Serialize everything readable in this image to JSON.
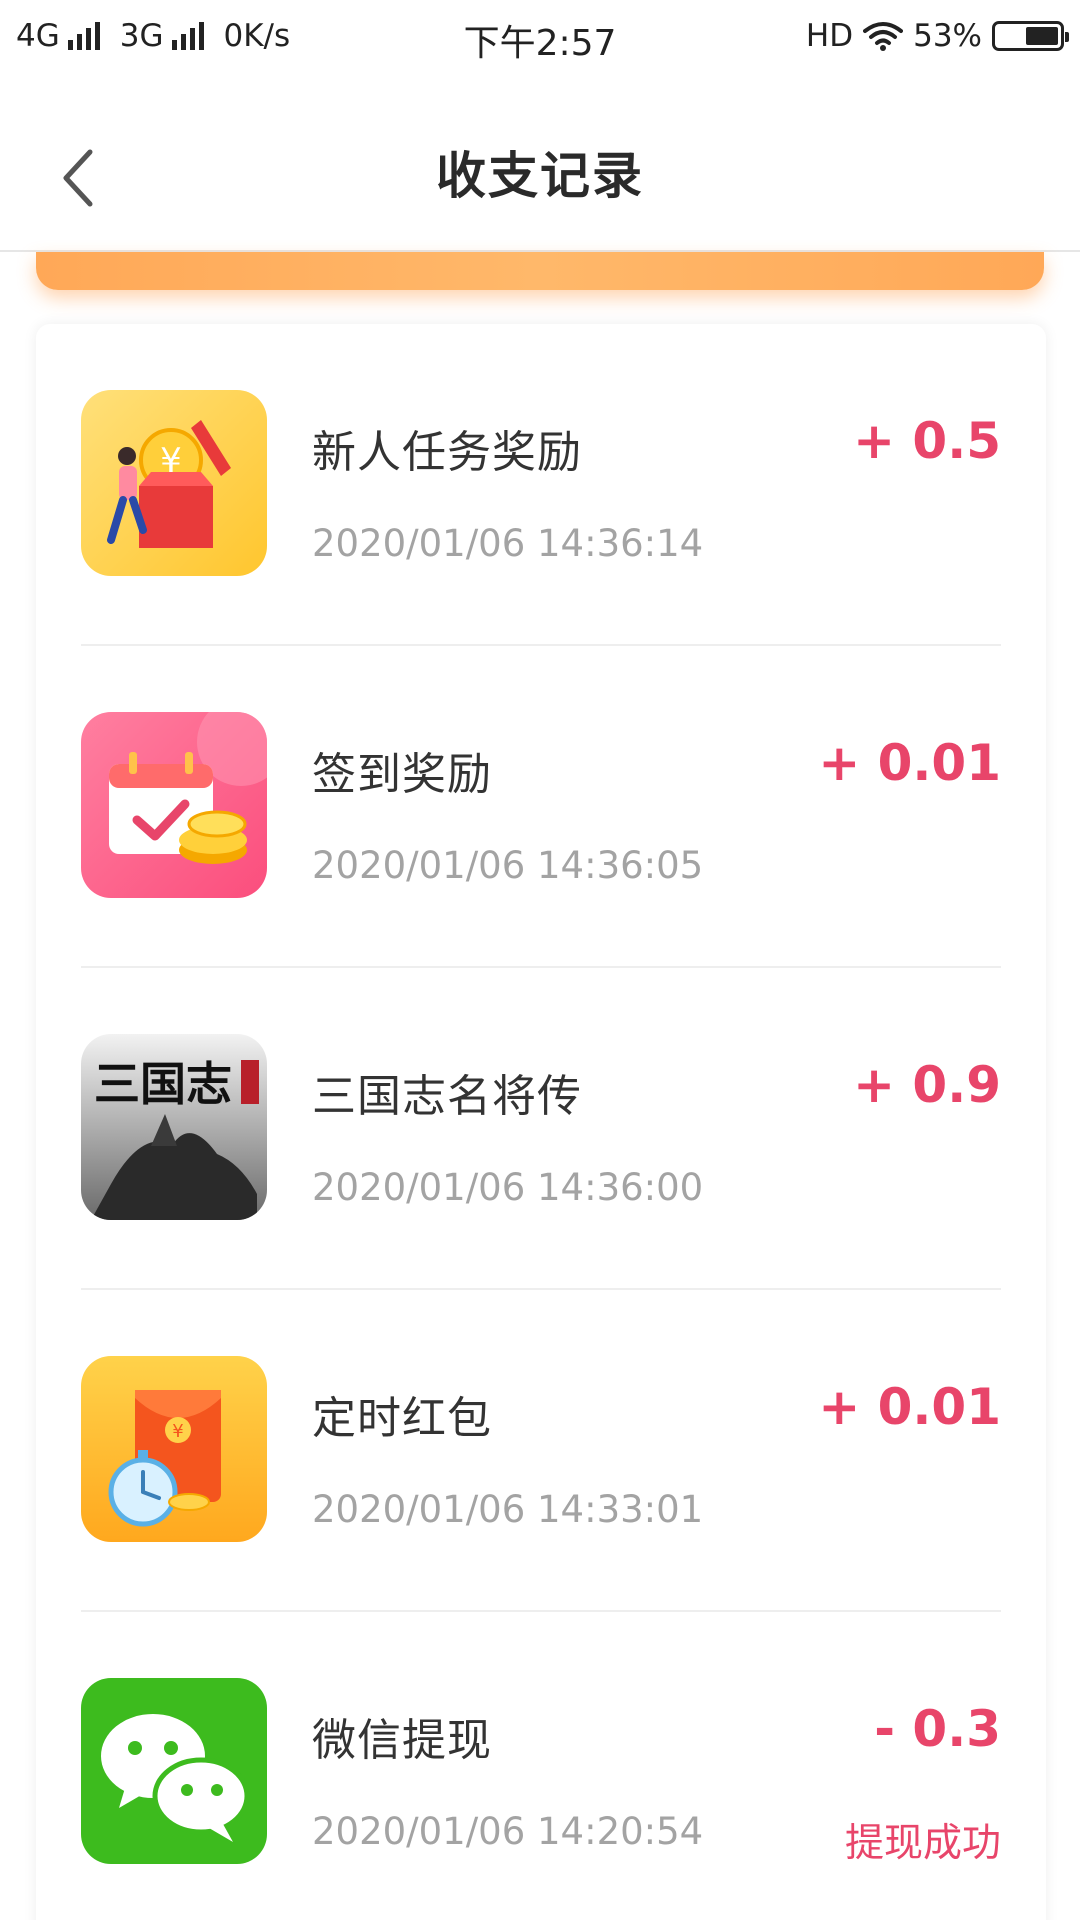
{
  "status_bar": {
    "network_1": "4G",
    "network_2": "3G",
    "speed": "0K/s",
    "time": "下午2:57",
    "hd": "HD",
    "battery": "53%",
    "battery_level": 0.53
  },
  "nav": {
    "title": "收支记录",
    "back_icon": "chevron-left-icon"
  },
  "colors": {
    "accent": "#e8456a",
    "banner": "#ffab5e"
  },
  "records": [
    {
      "icon": "gift-box-icon",
      "title": "新人任务奖励",
      "time": "2020/01/06 14:36:14",
      "amount": "+ 0.5",
      "status": ""
    },
    {
      "icon": "calendar-checkin-icon",
      "title": "签到奖励",
      "time": "2020/01/06 14:36:05",
      "amount": "+ 0.01",
      "status": ""
    },
    {
      "icon": "game-sanguozhi-icon",
      "title": "三国志名将传",
      "time": "2020/01/06 14:36:00",
      "amount": "+ 0.9",
      "status": "",
      "icon_text": "三国志"
    },
    {
      "icon": "red-envelope-timer-icon",
      "title": "定时红包",
      "time": "2020/01/06 14:33:01",
      "amount": "+ 0.01",
      "status": ""
    },
    {
      "icon": "wechat-icon",
      "title": "微信提现",
      "time": "2020/01/06 14:20:54",
      "amount": "- 0.3",
      "status": "提现成功"
    }
  ]
}
